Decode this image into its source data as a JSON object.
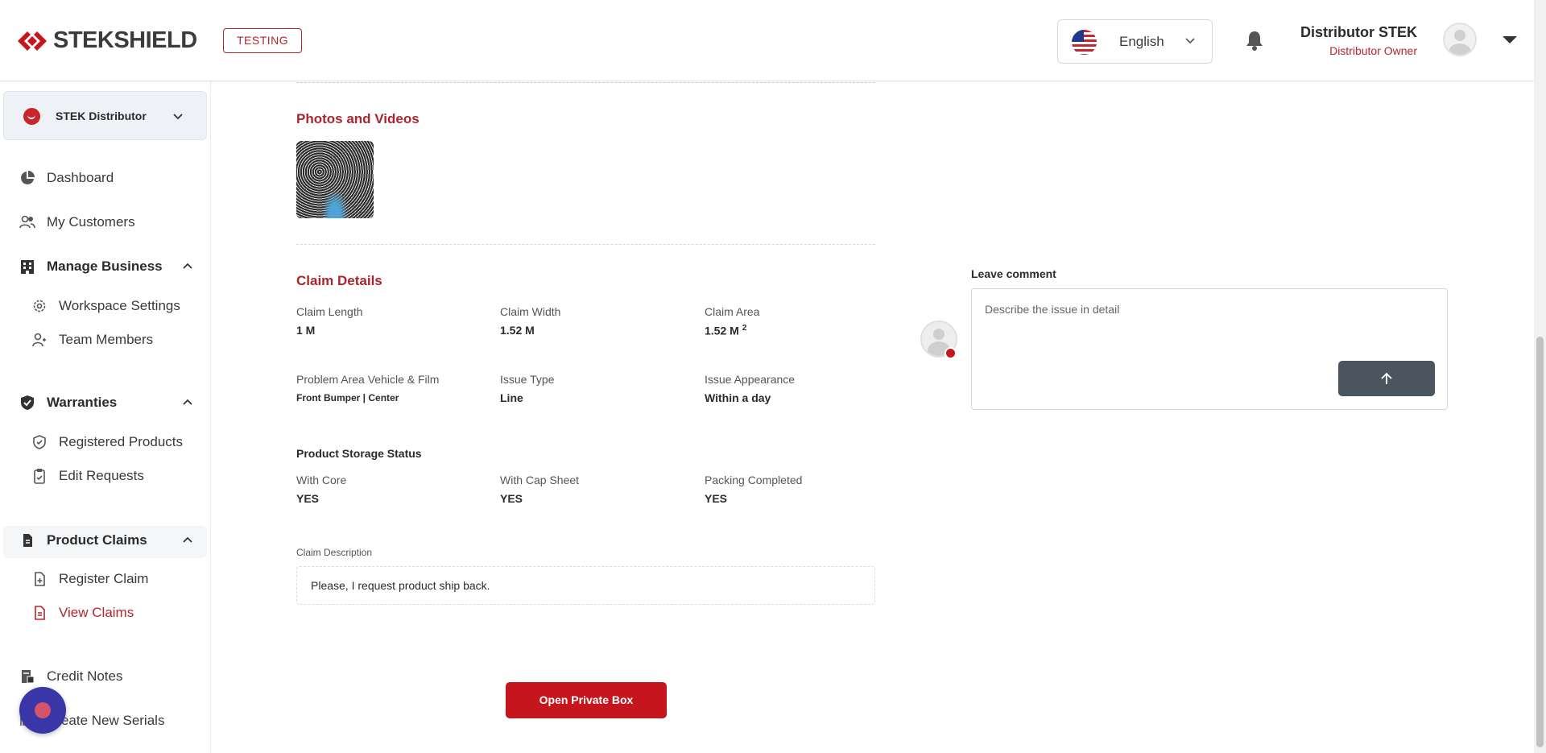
{
  "header": {
    "brand": "STEKSHIELD",
    "env_badge": "TESTING",
    "language": "English",
    "user_name": "Distributor STEK",
    "user_role": "Distributor Owner"
  },
  "sidebar": {
    "org_name": "STEK Distributor",
    "items": {
      "dashboard": "Dashboard",
      "my_customers": "My Customers",
      "manage_business": "Manage Business",
      "workspace_settings": "Workspace Settings",
      "team_members": "Team Members",
      "warranties": "Warranties",
      "registered_products": "Registered Products",
      "edit_requests": "Edit Requests",
      "product_claims": "Product Claims",
      "register_claim": "Register Claim",
      "view_claims": "View Claims",
      "credit_notes": "Credit Notes",
      "create_new_serials": "Create New Serials"
    }
  },
  "main": {
    "photos_title": "Photos and Videos",
    "claim_details_title": "Claim Details",
    "claim_length_label": "Claim Length",
    "claim_length_value": "1 M",
    "claim_width_label": "Claim Width",
    "claim_width_value": "1.52 M",
    "claim_area_label": "Claim Area",
    "claim_area_value": "1.52 M",
    "claim_area_sup": "2",
    "problem_area_label": "Problem Area Vehicle & Film",
    "problem_area_value": "Front Bumper | Center",
    "issue_type_label": "Issue Type",
    "issue_type_value": "Line",
    "issue_appearance_label": "Issue Appearance",
    "issue_appearance_value": "Within a day",
    "storage_title": "Product Storage Status",
    "with_core_label": "With Core",
    "with_core_value": "YES",
    "with_cap_label": "With Cap Sheet",
    "with_cap_value": "YES",
    "packing_label": "Packing Completed",
    "packing_value": "YES",
    "description_label": "Claim Description",
    "description_value": "Please, I request product ship back.",
    "open_private_box": "Open Private Box"
  },
  "comment": {
    "label": "Leave comment",
    "placeholder": "Describe the issue in detail"
  },
  "colors": {
    "brand_red": "#c4161c",
    "accent_dark_red": "#a8272c",
    "send_button": "#4a5560"
  }
}
